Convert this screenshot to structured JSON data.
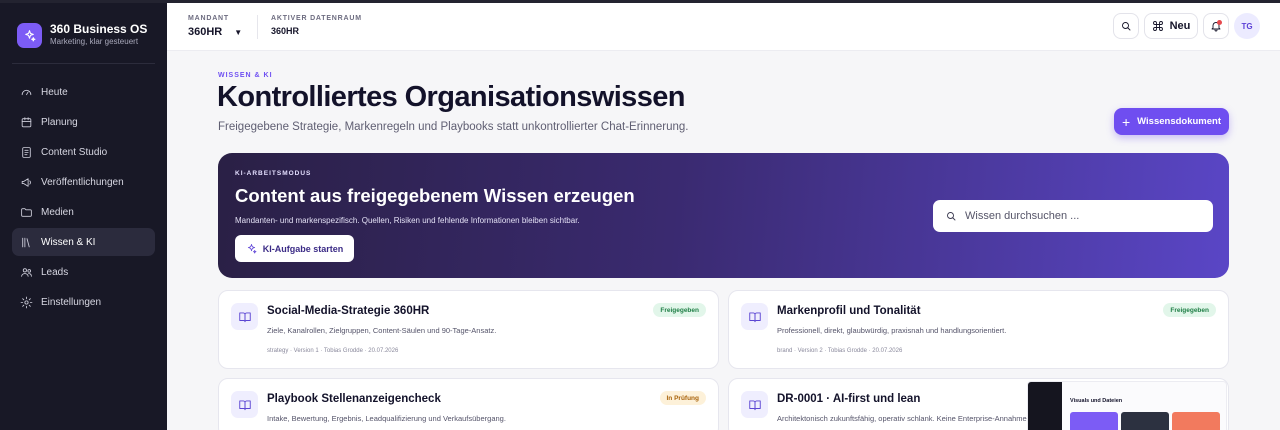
{
  "app": {
    "name": "360 Business OS",
    "tagline": "Marketing, klar gesteuert"
  },
  "sidebar": {
    "items": [
      {
        "label": "Heute",
        "icon": "gauge-icon"
      },
      {
        "label": "Planung",
        "icon": "calendar-icon"
      },
      {
        "label": "Content Studio",
        "icon": "document-icon"
      },
      {
        "label": "Veröffentlichungen",
        "icon": "megaphone-icon"
      },
      {
        "label": "Medien",
        "icon": "folder-icon"
      },
      {
        "label": "Wissen & KI",
        "icon": "library-icon",
        "active": true
      },
      {
        "label": "Leads",
        "icon": "users-icon"
      },
      {
        "label": "Einstellungen",
        "icon": "gear-icon"
      }
    ]
  },
  "header": {
    "mandant_label": "MANDANT",
    "mandant_value": "360HR",
    "datenraum_label": "AKTIVER DATENRAUM",
    "datenraum_value": "360HR",
    "new_label": "Neu",
    "avatar_initials": "TG"
  },
  "page": {
    "eyebrow": "WISSEN & KI",
    "title": "Kontrolliertes Organisationswissen",
    "subtitle": "Freigegebene Strategie, Markenregeln und Playbooks statt unkontrollierter Chat-Erinnerung.",
    "primary_action": "Wissensdokument"
  },
  "hero": {
    "eyebrow": "KI-ARBEITSMODUS",
    "title": "Content aus freigegebenem Wissen erzeugen",
    "subtitle": "Mandanten- und markenspezifisch. Quellen, Risiken und fehlende Informationen bleiben sichtbar.",
    "button": "KI-Aufgabe starten",
    "search_placeholder": "Wissen durchsuchen ..."
  },
  "cards": [
    {
      "title": "Social-Media-Strategie 360HR",
      "description": "Ziele, Kanalrollen, Zielgruppen, Content-Säulen und 90-Tage-Ansatz.",
      "meta": "strategy · Version 1 · Tobias Grodde · 20.07.2026",
      "badge": "Freigegeben",
      "badge_type": "green"
    },
    {
      "title": "Markenprofil und Tonalität",
      "description": "Professionell, direkt, glaubwürdig, praxisnah und handlungsorientiert.",
      "meta": "brand · Version 2 · Tobias Grodde · 20.07.2026",
      "badge": "Freigegeben",
      "badge_type": "green"
    },
    {
      "title": "Playbook Stellenanzeigencheck",
      "description": "Intake, Bewertung, Ergebnis, Leadqualifizierung und Verkaufsübergang.",
      "meta": "",
      "badge": "In Prüfung",
      "badge_type": "amber"
    },
    {
      "title": "DR-0001 · AI-first und lean",
      "description": "Architektonisch zukunftsfähig, operativ schlank. Keine Enterprise-Annahmen o",
      "meta": "",
      "badge": "",
      "badge_type": ""
    }
  ],
  "thumbnail": {
    "title": "Visuals und Dateien",
    "colors": [
      "#7c5cf5",
      "#2c3140",
      "#f27a5e"
    ]
  }
}
